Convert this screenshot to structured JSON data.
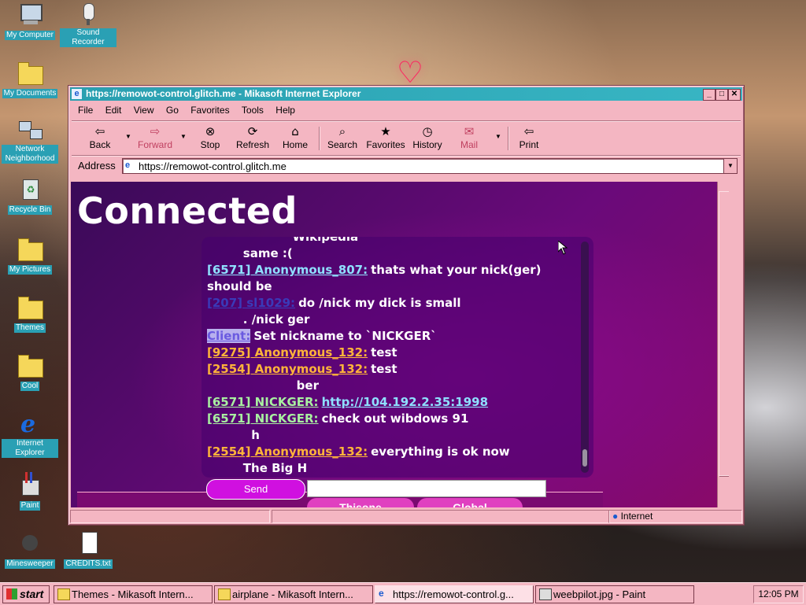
{
  "desktop": {
    "icons": [
      {
        "label": "My Computer",
        "icon": "computer-icon"
      },
      {
        "label": "Sound Recorder",
        "icon": "microphone-icon"
      },
      {
        "label": "My Documents",
        "icon": "folder-icon"
      },
      {
        "label": "Network Neighborhood",
        "icon": "network-icon"
      },
      {
        "label": "Recycle Bin",
        "icon": "recycle-bin-icon"
      },
      {
        "label": "My Pictures",
        "icon": "folder-icon"
      },
      {
        "label": "Themes",
        "icon": "folder-icon"
      },
      {
        "label": "Cool",
        "icon": "folder-icon"
      },
      {
        "label": "Internet Explorer",
        "icon": "internet-explorer-icon"
      },
      {
        "label": "Paint",
        "icon": "paint-icon"
      },
      {
        "label": "Minesweeper",
        "icon": "minesweeper-icon"
      },
      {
        "label": "CREDITS.txt",
        "icon": "text-file-icon"
      }
    ]
  },
  "window": {
    "title": "https://remowot-control.glitch.me - Mikasoft Internet Explorer",
    "menu": [
      "File",
      "Edit",
      "View",
      "Go",
      "Favorites",
      "Tools",
      "Help"
    ],
    "toolbar": {
      "back": "Back",
      "forward": "Forward",
      "stop": "Stop",
      "refresh": "Refresh",
      "home": "Home",
      "search": "Search",
      "favorites": "Favorites",
      "history": "History",
      "mail": "Mail",
      "print": "Print"
    },
    "address_label": "Address",
    "address_value": "https://remowot-control.glitch.me",
    "status_zone": "Internet"
  },
  "page": {
    "heading": "Connected",
    "send_label": "Send",
    "tabs": [
      "Thisone",
      "Global"
    ],
    "chat": [
      {
        "nick": "",
        "text": "Wikipedia"
      },
      {
        "nick": "",
        "text": "same :("
      },
      {
        "nick": "[6571] Anonymous_807:",
        "text": "thats what your nick(ger) should be"
      },
      {
        "nick": "[207] sl1029:",
        "text": "do /nick my dick is small"
      },
      {
        "nick": "",
        "text": ". /nick ger"
      },
      {
        "nick": "Client:",
        "text": "Set nickname to `NICKGER`"
      },
      {
        "nick": "[9275] Anonymous_132:",
        "text": "test"
      },
      {
        "nick": "[2554] Anonymous_132:",
        "text": "test"
      },
      {
        "nick": "",
        "text": "ber"
      },
      {
        "nick": "[6571] NICKGER:",
        "text": "http://104.192.2.35:1998"
      },
      {
        "nick": "[6571] NICKGER:",
        "text": "check out wibdows 91"
      },
      {
        "nick": "",
        "text": "h"
      },
      {
        "nick": "[2554] Anonymous_132:",
        "text": "everything is ok now"
      },
      {
        "nick": "",
        "text": "The Big H"
      }
    ]
  },
  "taskbar": {
    "start": "start",
    "tasks": [
      "Themes - Mikasoft Intern...",
      "airplane - Mikasoft Intern...",
      "https://remowot-control.g...",
      "weebpilot.jpg - Paint"
    ],
    "clock": "12:05 PM"
  }
}
